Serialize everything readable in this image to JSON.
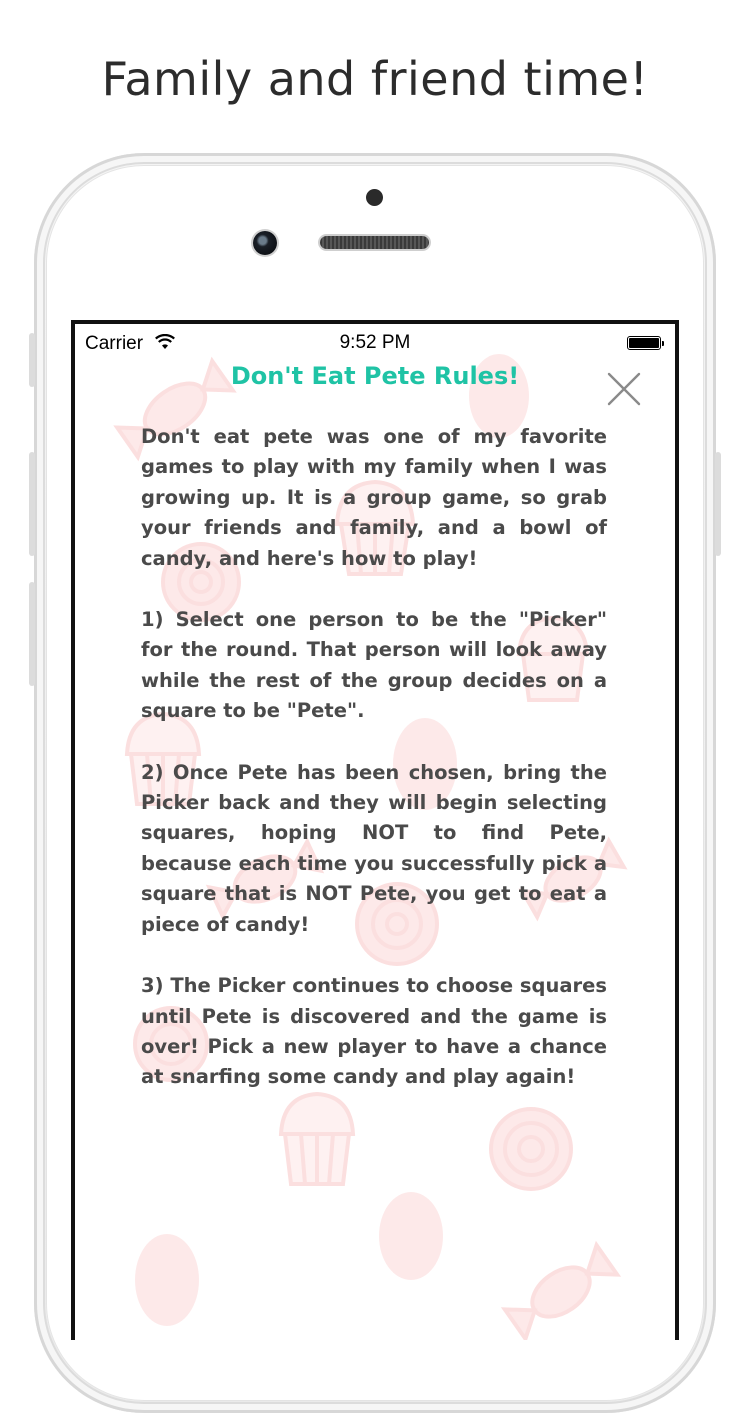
{
  "headline": "Family and friend time!",
  "status_bar": {
    "carrier": "Carrier",
    "time": "9:52 PM"
  },
  "modal": {
    "title": "Don't Eat Pete Rules!",
    "close_icon": "close-x-icon",
    "paragraphs": [
      "Don't eat pete was one of my favorite games to play with my family when I was growing up. It is a group game, so grab your friends and family, and a bowl of candy, and here's how to play!",
      "1) Select one person to be the \"Picker\" for the round. That person will look away while the rest of the group decides on a square to be \"Pete\".",
      "2) Once Pete has been chosen, bring the Picker back and they will begin selecting squares, hoping NOT to find Pete, because each time you successfully pick a square that is NOT Pete, you get to eat a piece of candy!",
      "3) The Picker continues to choose squares until Pete is discovered and the game is over! Pick a new player to have a chance at snarfing some candy and play again!"
    ]
  },
  "colors": {
    "title": "#1fc3a5",
    "body_text": "#4a4a4a",
    "candy_pattern": "#fbe1e1"
  },
  "background_icons": [
    "candy-wrapper-icon",
    "egg-icon",
    "cupcake-icon",
    "swirl-candy-icon"
  ]
}
